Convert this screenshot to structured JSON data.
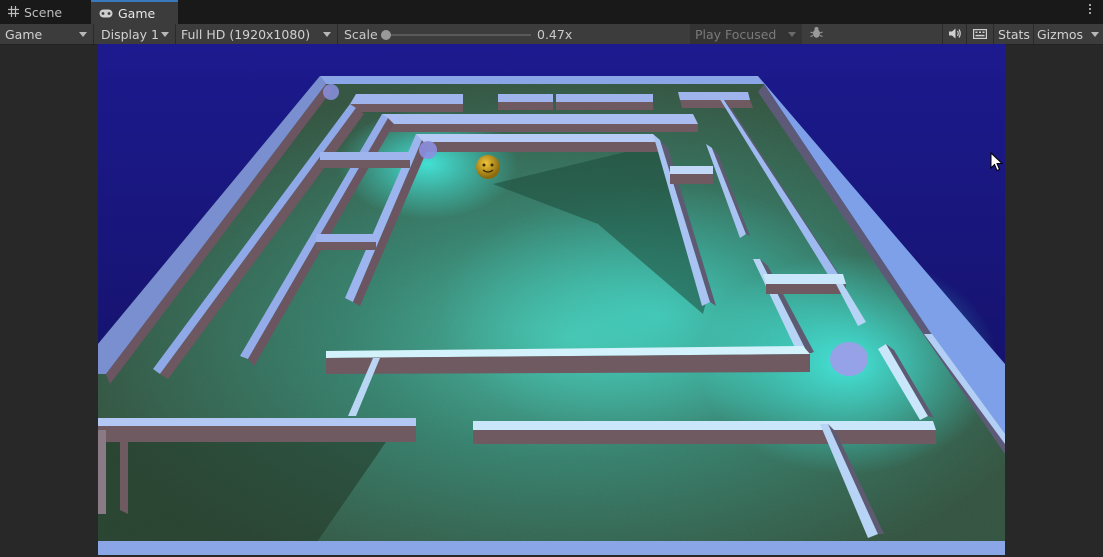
{
  "tabs": [
    {
      "label": "Scene",
      "icon": "grid-icon",
      "active": false
    },
    {
      "label": "Game",
      "icon": "gamepad-icon",
      "active": true
    }
  ],
  "toolbar": {
    "game_dropdown": "Game",
    "display_dropdown": "Display 1",
    "resolution_dropdown": "Full HD (1920x1080)",
    "scale_label": "Scale",
    "scale_value": "0.47x",
    "scale_fraction": 0.0,
    "play_mode_dropdown": "Play Focused",
    "bug_icon": "bug-icon",
    "audio_icon": "speaker-icon",
    "keyboard_icon": "keyboard-icon",
    "stats_label": "Stats",
    "gizmos_label": "Gizmos"
  },
  "viewport": {
    "scene": "3D maze game view",
    "sky_color": "#1b1a8a",
    "floor_color": "#2f5a3a",
    "wall_color": "#6c7fc4",
    "light_color": "#35f0e6",
    "ball_color": "#d9a51a"
  }
}
